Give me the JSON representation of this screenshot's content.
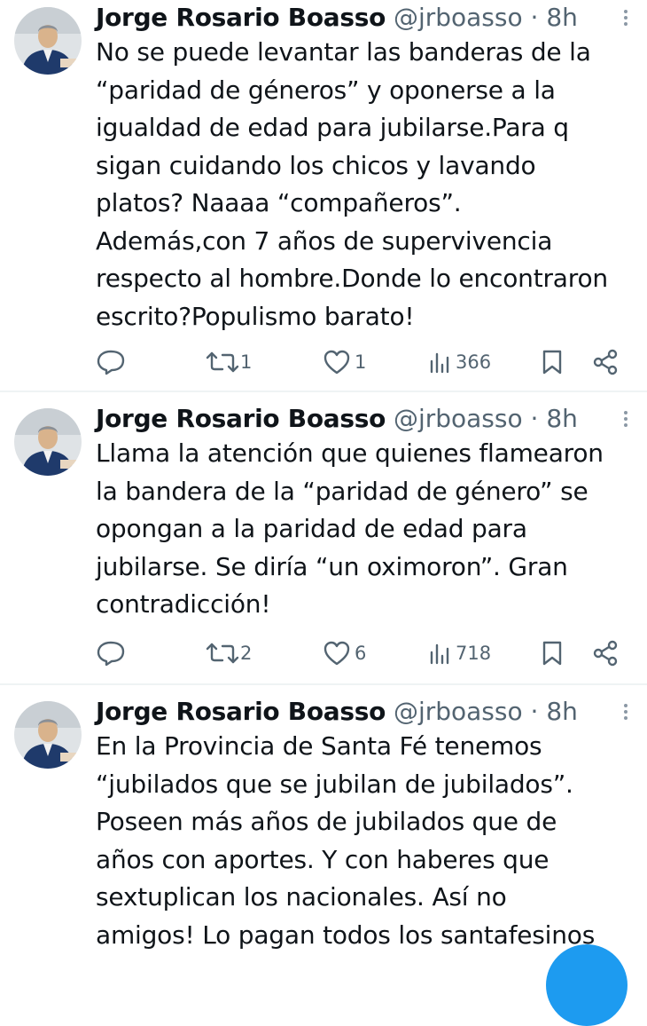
{
  "tweets": [
    {
      "name": "Jorge Rosario Boasso",
      "handle": "@jrboasso",
      "separator": "·",
      "time": "8h",
      "text": "No se puede levantar las banderas de la\n“paridad de géneros” y oponerse a la\nigualdad de edad para jubilarse.Para q\nsigan cuidando los chicos y lavando\nplatos? Naaaa “compañeros”.\nAdemás,con 7 años de supervivencia\nrespecto al hombre.Donde lo encontraron\nescrito?Populismo barato!",
      "reposts": "1",
      "likes": "1",
      "views": "366"
    },
    {
      "name": "Jorge Rosario Boasso",
      "handle": "@jrboasso",
      "separator": "·",
      "time": "8h",
      "text": "Llama la atención que quienes flamearon\nla bandera de la “paridad de género” se\nopongan a la paridad de edad para\njubilarse. Se diría “un oximoron”. Gran\ncontradicción!",
      "reposts": "2",
      "likes": "6",
      "views": "718"
    },
    {
      "name": "Jorge Rosario Boasso",
      "handle": "@jrboasso",
      "separator": "·",
      "time": "8h",
      "text": "En la Provincia de Santa Fé tenemos\n“jubilados que se jubilan de jubilados”.\nPoseen más años de jubilados que de\naños con aportes. Y con haberes que\nsextuplican los nacionales. Así no\namigos! Lo pagan todos los santafesinos"
    }
  ],
  "icons": {
    "reply": "reply-icon",
    "repost": "repost-icon",
    "like": "like-icon",
    "views": "views-icon",
    "bookmark": "bookmark-icon",
    "share": "share-icon",
    "more": "more-icon",
    "compose": "compose-fab"
  },
  "colors": {
    "text": "#0f1419",
    "muted": "#536471",
    "accent": "#1d9bf0",
    "divider": "#eff3f4"
  }
}
